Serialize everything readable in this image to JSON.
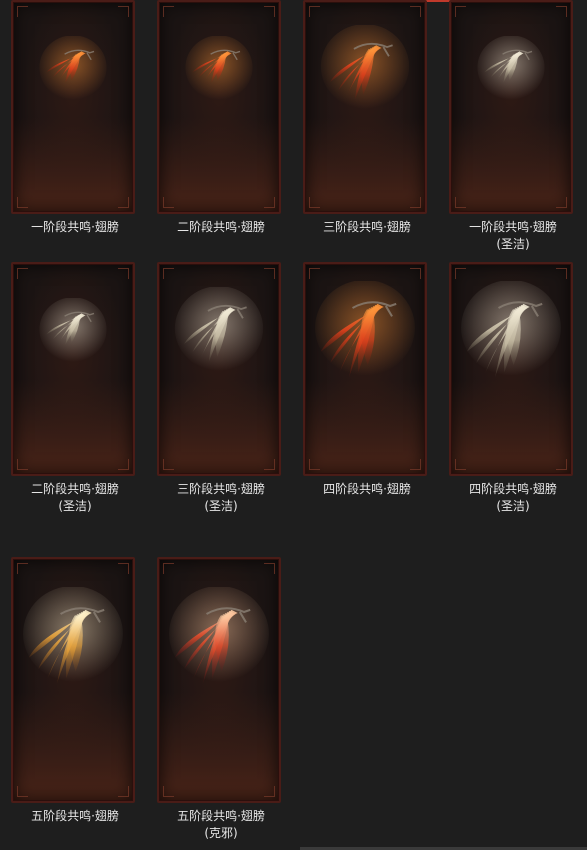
{
  "items": [
    {
      "label": "一阶段共鸣·翅膀",
      "variant": "fire",
      "scale": "small",
      "icon": "wing-icon"
    },
    {
      "label": "二阶段共鸣·翅膀",
      "variant": "fire",
      "scale": "small",
      "icon": "wing-icon"
    },
    {
      "label": "三阶段共鸣·翅膀",
      "variant": "fire",
      "scale": "medium",
      "icon": "wing-icon"
    },
    {
      "label": "一阶段共鸣·翅膀\n(圣洁)",
      "variant": "holy",
      "scale": "small",
      "icon": "wing-icon"
    },
    {
      "label": "二阶段共鸣·翅膀\n(圣洁)",
      "variant": "holy",
      "scale": "small",
      "icon": "wing-icon"
    },
    {
      "label": "三阶段共鸣·翅膀\n(圣洁)",
      "variant": "holy",
      "scale": "medium",
      "icon": "wing-icon"
    },
    {
      "label": "四阶段共鸣·翅膀",
      "variant": "fire",
      "scale": "large",
      "icon": "wing-icon"
    },
    {
      "label": "四阶段共鸣·翅膀\n(圣洁)",
      "variant": "holy",
      "scale": "large",
      "icon": "wing-icon"
    },
    {
      "label": "五阶段共鸣·翅膀",
      "variant": "gold",
      "scale": "large",
      "icon": "wing-icon"
    },
    {
      "label": "五阶段共鸣·翅膀\n(克邪)",
      "variant": "crimson",
      "scale": "large",
      "icon": "wing-icon"
    }
  ],
  "colors": {
    "background": "#1e1e1e",
    "card_border": "#4a1c17",
    "label_text": "#e6e6e6",
    "fire": [
      "#ff9a3c",
      "#e0401c",
      "#7a1a0c"
    ],
    "holy": [
      "#f3ecd8",
      "#c9bfa6",
      "#6b6250"
    ],
    "gold": [
      "#fff4d0",
      "#e8a33a",
      "#8a4a12"
    ],
    "crimson": [
      "#ffd1a8",
      "#e04a2a",
      "#6a0f14"
    ]
  }
}
